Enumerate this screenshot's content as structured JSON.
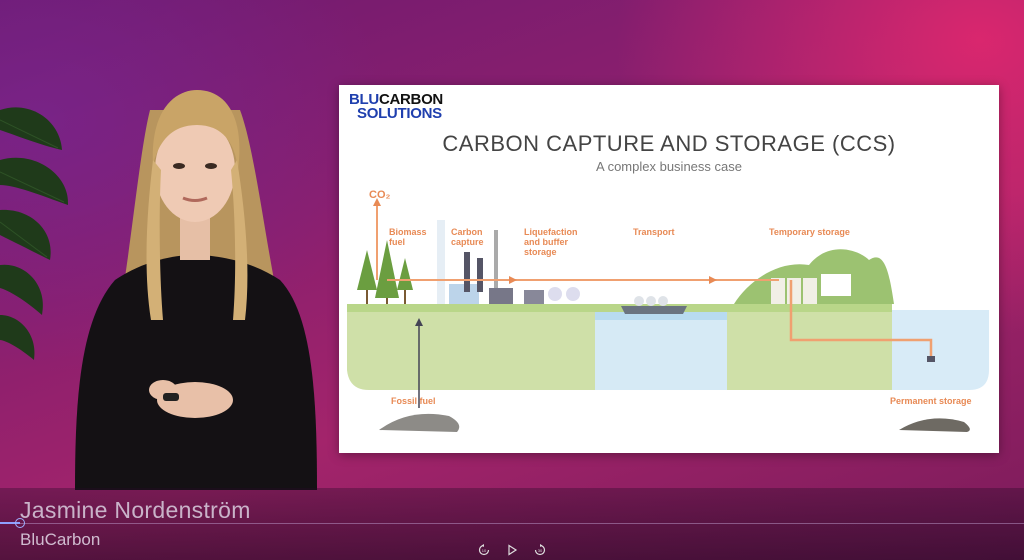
{
  "video": {
    "speaker_name": "Jasmine Nordenström",
    "speaker_company": "BluCarbon",
    "progress_percent": 2,
    "controls": {
      "rewind_label": "10",
      "forward_label": "30"
    }
  },
  "slide": {
    "brand_blu": "BLU",
    "brand_carbon": "CARBON",
    "brand_solutions": "SOLUTIONS",
    "title": "CARBON CAPTURE AND STORAGE (CCS)",
    "subtitle": "A complex business case",
    "co2_label": "CO₂",
    "labels": {
      "biomass": [
        "Biomass",
        "fuel"
      ],
      "capture": [
        "Carbon",
        "capture"
      ],
      "liquefaction": [
        "Liquefaction",
        "and buffer",
        "storage"
      ],
      "transport": "Transport",
      "temporary": "Temporary storage",
      "fossil": "Fossil fuel",
      "permanent": "Permanent storage"
    }
  },
  "colors": {
    "accent_orange": "#e88a55",
    "brand_blue": "#1f3fae",
    "land_green": "#c9dba0",
    "water_blue": "#d4e8f4"
  }
}
